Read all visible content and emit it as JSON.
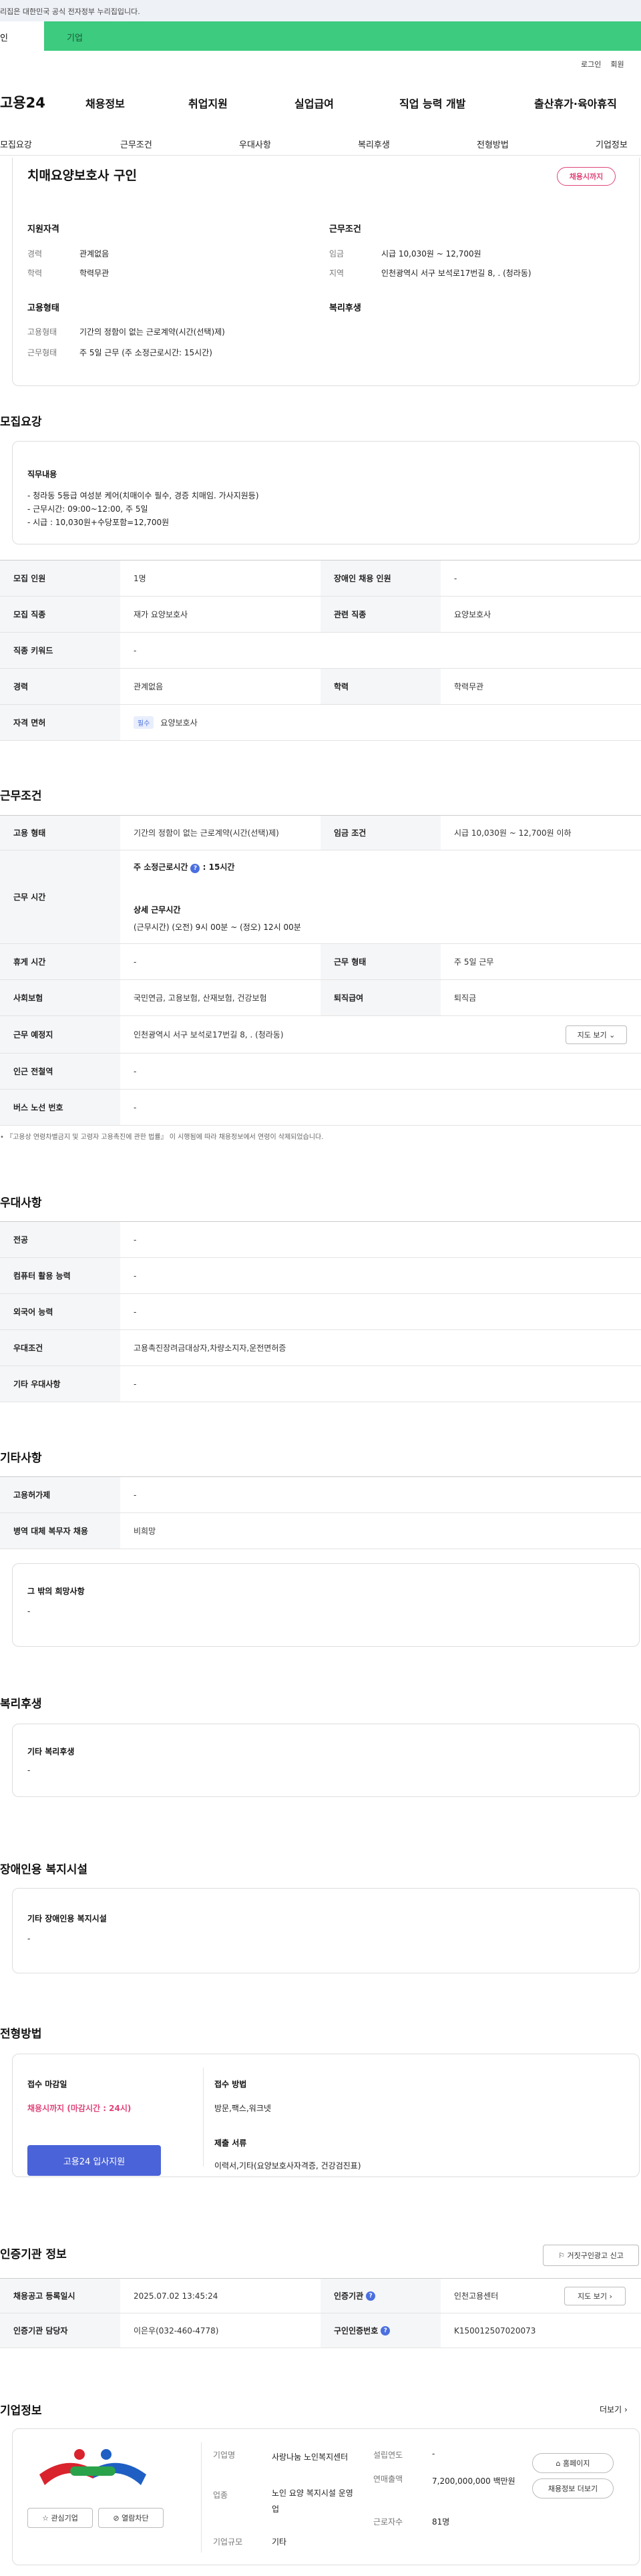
{
  "gov_banner": "리집은 대한민국 공식 전자정부 누리집입니다.",
  "top_tabs": [
    "인",
    "기업"
  ],
  "util": [
    "로그인",
    "회원"
  ],
  "logo": "고용24",
  "gnb": [
    "채용정보",
    "취업지원",
    "실업급여",
    "직업 능력 개발",
    "출산휴가·육아휴직"
  ],
  "subnav": [
    "모집요강",
    "근무조건",
    "우대사항",
    "복리후생",
    "전형방법",
    "기업정보"
  ],
  "summary": {
    "title": "치매요양보호사 구인",
    "badge": "채용시까지",
    "qual_h": "지원자격",
    "cond_h": "근무조건",
    "type_h": "고용형태",
    "welfare_h": "복리후생",
    "career_l": "경력",
    "career_v": "관계없음",
    "edu_l": "학력",
    "edu_v": "학력무관",
    "wage_l": "임금",
    "wage_v": "시급 10,030원 ~ 12,700원",
    "area_l": "지역",
    "area_v": "인천광역시 서구 보석로17번길 8, . (청라동)",
    "emp_l": "고용형태",
    "emp_v": "기간의 정함이 없는 근로계약(시간(선택)제)",
    "work_l": "근무형태",
    "work_v": "주 5일 근무 (주 소정근로시간: 15시간)"
  },
  "recruit": {
    "title": "모집요강",
    "duty_h": "직무내용",
    "duty": [
      "- 청라동 5등급 여성분 케어(치매이수 필수, 경증 치매임. 가사지원등)",
      "- 근무시간: 09:00~12:00, 주 5일",
      "- 시급 : 10,030원+수당포함=12,700원"
    ],
    "rows": [
      [
        "모집 인원",
        "1명",
        "장애인 채용 인원",
        "-"
      ],
      [
        "모집 직종",
        "재가 요양보호사",
        "관련 직종",
        "요양보호사"
      ],
      [
        "직종 키워드",
        "-"
      ],
      [
        "경력",
        "관계없음",
        "학력",
        "학력무관"
      ]
    ],
    "license_h": "자격 면허",
    "license_tag": "필수",
    "license_v": "요양보호사"
  },
  "cond": {
    "title": "근무조건",
    "emp_h": "고용 형태",
    "emp_v": "기간의 정함이 없는 근로계약(시간(선택)제)",
    "wage_h": "임금 조건",
    "wage_v": "시급 10,030원 ~ 12,700원 이하",
    "time_h": "근무 시간",
    "hours_h": "주 소정근로시간",
    "hours_v": "15시간",
    "detail_h": "상세 근무시간",
    "detail_v": "(근무시간) (오전) 9시 00분 ~ (정오) 12시 00분",
    "rest_h": "휴게 시간",
    "rest_v": "-",
    "form_h": "근무 형태",
    "form_v": "주 5일 근무",
    "ins_h": "사회보험",
    "ins_v": "국민연금, 고용보험, 산재보험, 건강보험",
    "sev_h": "퇴직급여",
    "sev_v": "퇴직금",
    "place_h": "근무 예정지",
    "place_v": "인천광역시 서구 보석로17번길 8, . (청라동)",
    "map_btn": "지도 보기",
    "sub_h": "인근 전철역",
    "sub_v": "-",
    "bus_h": "버스 노선 번호",
    "bus_v": "-",
    "note": "• 『고용상 연령차별금지 및 고령자 고용촉진에 관한 법률』 이 시행됨에 따라 채용정보에서 연령이 삭제되었습니다."
  },
  "pref": {
    "title": "우대사항",
    "rows": [
      [
        "전공",
        "-"
      ],
      [
        "컴퓨터 활용 능력",
        "-"
      ],
      [
        "외국어 능력",
        "-"
      ],
      [
        "우대조건",
        "고용촉진장려금대상자,차량소지자,운전면허증"
      ],
      [
        "기타 우대사항",
        "-"
      ]
    ]
  },
  "etc": {
    "title": "기타사항",
    "rows": [
      [
        "고용허가제",
        "-"
      ],
      [
        "병역 대체 복무자 채용",
        "비희망"
      ]
    ],
    "hope_h": "그 밖의 희망사항",
    "hope_v": "-"
  },
  "welfare": {
    "title": "복리후생",
    "h": "기타 복리후생",
    "v": "-"
  },
  "disabled": {
    "title": "장애인용 복지시설",
    "h": "기타 장애인용 복지시설",
    "v": "-"
  },
  "select": {
    "title": "전형방법",
    "deadline_h": "접수 마감일",
    "deadline_v": "채용시까지 (마감시간 : 24시)",
    "apply_btn": "고용24 입사지원",
    "method_h": "접수 방법",
    "method_v": "방문,팩스,워크넷",
    "docs_h": "제출 서류",
    "docs_v": "이력서,기타(요양보호사자격증, 건강검진표)"
  },
  "cert": {
    "title": "인증기관 정보",
    "report_btn": "거짓구인광고 신고",
    "reg_h": "채용공고 등록일시",
    "reg_v": "2025.07.02 13:45:24",
    "org_h": "인증기관",
    "org_v": "인천고용센터",
    "map_btn": "지도 보기",
    "mgr_h": "인증기관 담당자",
    "mgr_v": "이은우(032-460-4778)",
    "num_h": "구인인증번호",
    "num_v": "K150012507020073"
  },
  "company": {
    "title": "기업정보",
    "more": "더보기",
    "fav_btn": "관심기업",
    "block_btn": "열람차단",
    "name_l": "기업명",
    "name_v": "사랑나눔 노인복지센터",
    "biz_l": "업종",
    "biz_v": "노인 요양 복지시설 운영업",
    "size_l": "기업규모",
    "size_v": "기타",
    "year_l": "설립연도",
    "year_v": "-",
    "sales_l": "연매출액",
    "sales_v": "7,200,000,000 백만원",
    "emp_l": "근로자수",
    "emp_v": "81명",
    "home_btn": "홈페이지",
    "list_btn": "채용정보 더보기"
  },
  "colors": {
    "green": "#3ccb7f",
    "blue": "#4a6fe0",
    "pink": "#e0447a"
  }
}
